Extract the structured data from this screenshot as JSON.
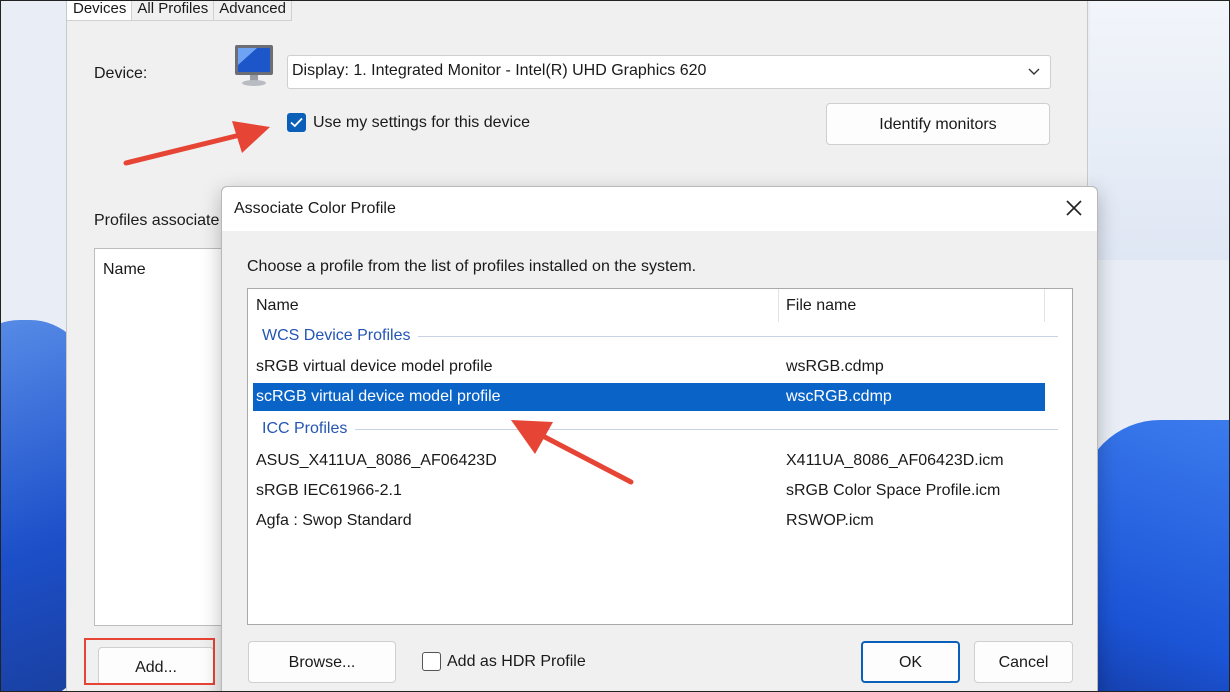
{
  "main_window": {
    "tabs": [
      "Devices",
      "All Profiles",
      "Advanced"
    ],
    "device_label": "Device:",
    "device_select_value": "Display: 1. Integrated Monitor - Intel(R) UHD Graphics 620",
    "use_settings_label": "Use my settings for this device",
    "use_settings_checked": true,
    "identify_button": "Identify monitors",
    "profiles_label": "Profiles associate",
    "profiles_list_header": "Name",
    "add_button": "Add..."
  },
  "dialog": {
    "title": "Associate Color Profile",
    "prompt": "Choose a profile from the list of profiles installed on the system.",
    "columns": [
      "Name",
      "File name"
    ],
    "groups": [
      {
        "name": "WCS Device Profiles",
        "rows": [
          {
            "name": "sRGB virtual device model profile",
            "file": "wsRGB.cdmp"
          },
          {
            "name": "scRGB virtual device model profile",
            "file": "wscRGB.cdmp",
            "selected": true
          }
        ]
      },
      {
        "name": "ICC Profiles",
        "rows": [
          {
            "name": "ASUS_X411UA_8086_AF06423D",
            "file": "X411UA_8086_AF06423D.icm"
          },
          {
            "name": "sRGB IEC61966-2.1",
            "file": "sRGB Color Space Profile.icm"
          },
          {
            "name": "Agfa : Swop Standard",
            "file": "RSWOP.icm"
          }
        ]
      }
    ],
    "browse_button": "Browse...",
    "hdr_checkbox_label": "Add as HDR Profile",
    "hdr_checked": false,
    "ok_button": "OK",
    "cancel_button": "Cancel"
  },
  "colors": {
    "accent": "#0a64c8",
    "group_header": "#2455b3",
    "annotation_red": "#e64535"
  },
  "icons": {
    "monitor": "monitor-icon",
    "close": "close-icon",
    "chevron": "chevron-down-icon",
    "check": "check-icon"
  }
}
